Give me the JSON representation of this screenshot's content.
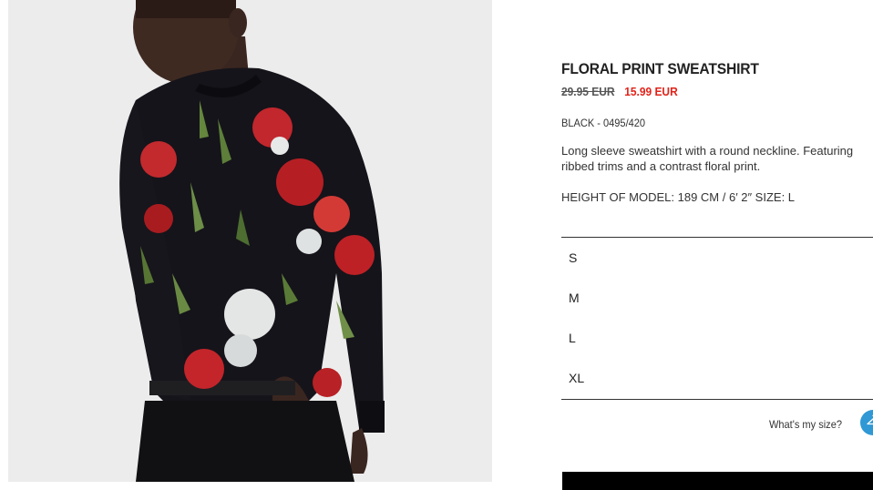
{
  "product": {
    "name": "FLORAL PRINT SWEATSHIRT",
    "old_price": "29.95 EUR",
    "sale_price": "15.99 EUR",
    "color_ref": "BLACK - 0495/420",
    "description": "Long sleeve sweatshirt with a round neckline. Featuring ribbed trims and a contrast floral print.",
    "model_info": "HEIGHT OF MODEL: 189 CM / 6′ 2″ SIZE: L"
  },
  "sizes": [
    "S",
    "M",
    "L",
    "XL"
  ],
  "size_help": {
    "label": "What's my size?"
  },
  "colors": {
    "sale": "#e2231a",
    "help_icon_bg": "#2f98d5"
  }
}
